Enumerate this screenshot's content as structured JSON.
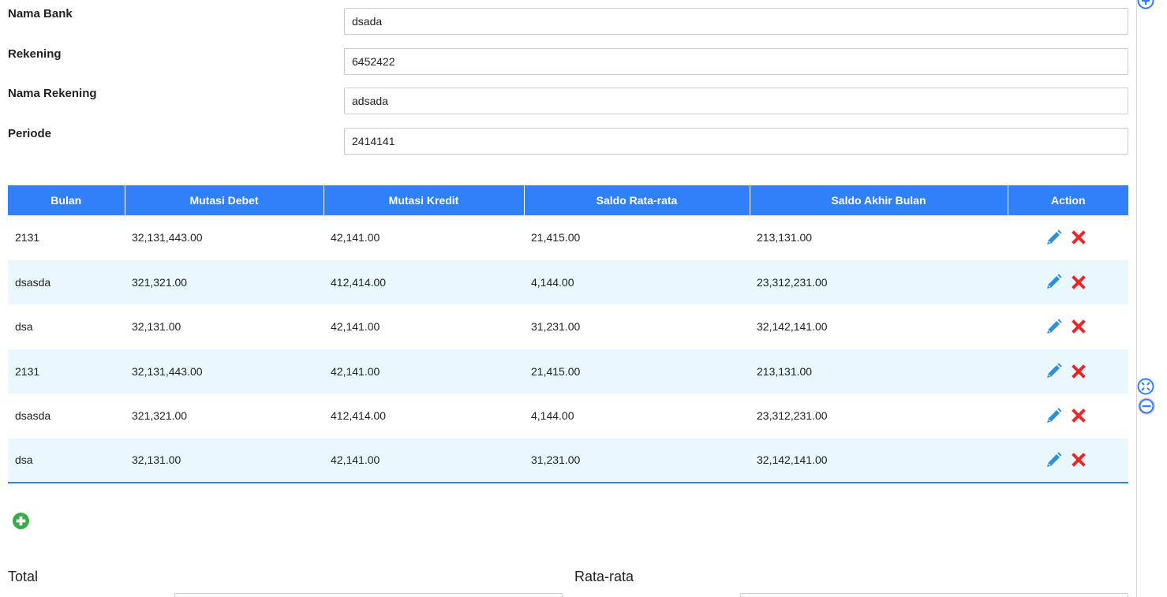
{
  "form": {
    "fields": [
      {
        "label": "Nama Bank",
        "value": "dsada"
      },
      {
        "label": "Rekening",
        "value": "6452422"
      },
      {
        "label": "Nama Rekening",
        "value": "adsada"
      },
      {
        "label": "Periode",
        "value": "2414141"
      }
    ]
  },
  "table": {
    "headers": [
      "Bulan",
      "Mutasi Debet",
      "Mutasi Kredit",
      "Saldo Rata-rata",
      "Saldo Akhir Bulan",
      "Action"
    ],
    "rows": [
      [
        "2131",
        "32,131,443.00",
        "42,141.00",
        "21,415.00",
        "213,131.00"
      ],
      [
        "dsasda",
        "321,321.00",
        "412,414.00",
        "4,144.00",
        "23,312,231.00"
      ],
      [
        "dsa",
        "32,131.00",
        "42,141.00",
        "31,231.00",
        "32,142,141.00"
      ],
      [
        "2131",
        "32,131,443.00",
        "42,141.00",
        "21,415.00",
        "213,131.00"
      ],
      [
        "dsasda",
        "321,321.00",
        "412,414.00",
        "4,144.00",
        "23,312,231.00"
      ],
      [
        "dsa",
        "32,131.00",
        "42,141.00",
        "31,231.00",
        "32,142,141.00"
      ]
    ]
  },
  "summary": {
    "total_label": "Total",
    "average_label": "Rata-rata"
  },
  "colors": {
    "header_bg": "#2f80f9",
    "row_alt": "#e8f8fd",
    "edit_icon": "#2f8fd8",
    "delete_icon": "#e8282d",
    "add_icon": "#3aab4a"
  },
  "icons": {
    "edit": "pencil-icon",
    "delete": "cross-icon",
    "add": "plus-circle-icon",
    "side_top": "plus-circle-icon",
    "side_mid": "fullscreen-icon",
    "side_bottom": "minus-circle-icon"
  }
}
